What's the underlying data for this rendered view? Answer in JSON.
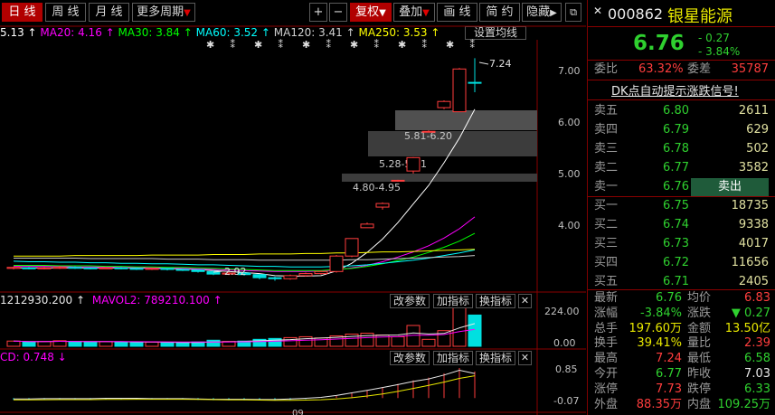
{
  "toolbar": {
    "period_buttons": [
      "日 线",
      "周 线",
      "月 线",
      "更多周期"
    ],
    "more_arrow": "▼",
    "zoom_in": "+",
    "zoom_out": "−",
    "fuquan": "复权",
    "fuquan_arrow": "▼",
    "overlay": "叠加",
    "overlay_arrow": "▼",
    "draw_line": "画 线",
    "brief": "简 约",
    "hide": "隐藏",
    "hide_arrow": "▶",
    "restore": "⧉",
    "close": "✕"
  },
  "ma_legend": {
    "ma5": "5.13 ↑",
    "ma20": "MA20: 4.16 ↑",
    "ma30": "MA30: 3.84 ↑",
    "ma60": "MA60: 3.52 ↑",
    "ma120": "MA120: 3.41 ↑",
    "ma250": "MA250: 3.53 ↑",
    "setting": "设置均线"
  },
  "price_axis": [
    "7.00",
    "6.00",
    "5.00",
    "4.00"
  ],
  "annotations": {
    "high": "7.24",
    "low": "2.92",
    "zones": [
      "5.81-6.20",
      "5.28-5.31",
      "4.80-4.95"
    ]
  },
  "vol_panel": {
    "legend_a": "1212930.200 ↑",
    "legend_b": "MAVOL2: 789210.100 ↑",
    "axis": [
      "224.00",
      "0.00"
    ],
    "buttons": [
      "改参数",
      "加指标",
      "换指标"
    ],
    "close": "✕"
  },
  "macd_panel": {
    "legend": "CD: 0.748 ↓",
    "axis": [
      "0.85",
      "-0.07"
    ],
    "buttons": [
      "改参数",
      "加指标",
      "换指标"
    ],
    "close": "✕"
  },
  "bottom_label": "09",
  "quote": {
    "code": "000862",
    "name": "银星能源",
    "price": "6.76",
    "change": "- 0.27",
    "change_pct": "- 3.84%",
    "weibi_label": "委比",
    "weibi": "63.32%",
    "weicha_label": "委差",
    "weicha": "35787",
    "signal": "DK点自动提示涨跌信号!",
    "sell": [
      {
        "label": "卖五",
        "price": "6.80",
        "vol": "2611"
      },
      {
        "label": "卖四",
        "price": "6.79",
        "vol": "629"
      },
      {
        "label": "卖三",
        "price": "6.78",
        "vol": "502"
      },
      {
        "label": "卖二",
        "price": "6.77",
        "vol": "3582"
      },
      {
        "label": "卖一",
        "price": "6.76",
        "vol": "卖出"
      }
    ],
    "buy": [
      {
        "label": "买一",
        "price": "6.75",
        "vol": "18735"
      },
      {
        "label": "买二",
        "price": "6.74",
        "vol": "9338"
      },
      {
        "label": "买三",
        "price": "6.73",
        "vol": "4017"
      },
      {
        "label": "买四",
        "price": "6.72",
        "vol": "11656"
      },
      {
        "label": "买五",
        "price": "6.71",
        "vol": "2405"
      }
    ],
    "stats": [
      {
        "l1": "最新",
        "v1": "6.76",
        "l2": "均价",
        "v2": "6.83"
      },
      {
        "l1": "涨幅",
        "v1": "-3.84%",
        "l2": "涨跌",
        "v2": "▼ 0.27"
      },
      {
        "l1": "总手",
        "v1": "197.60万",
        "l2": "金额",
        "v2": "13.50亿"
      },
      {
        "l1": "换手",
        "v1": "39.41%",
        "l2": "量比",
        "v2": "2.39"
      },
      {
        "l1": "最高",
        "v1": "7.24",
        "l2": "最低",
        "v2": "6.58"
      },
      {
        "l1": "今开",
        "v1": "6.77",
        "l2": "昨收",
        "v2": "7.03"
      },
      {
        "l1": "涨停",
        "v1": "7.73",
        "l2": "跌停",
        "v2": "6.33"
      },
      {
        "l1": "外盘",
        "v1": "88.35万",
        "l2": "内盘",
        "v2": "109.25万"
      }
    ]
  },
  "colors": {
    "up": "#ff3d3d",
    "down": "#00e0e0",
    "ma5": "#ffffff",
    "ma20": "#ff00ff",
    "ma30": "#00ff00",
    "ma60": "#00ffff",
    "ma120": "#ffffff",
    "ma250": "#ffff00",
    "accent": "#b10000"
  },
  "chart_data": {
    "type": "candlestick",
    "price_axis_ticks": [
      4.0,
      5.0,
      6.0,
      7.0
    ],
    "candles": [
      {
        "o": 3.16,
        "c": 3.18,
        "h": 3.2,
        "l": 3.14
      },
      {
        "o": 3.17,
        "c": 3.16,
        "h": 3.19,
        "l": 3.14
      },
      {
        "o": 3.16,
        "c": 3.17,
        "h": 3.19,
        "l": 3.14
      },
      {
        "o": 3.17,
        "c": 3.18,
        "h": 3.21,
        "l": 3.15
      },
      {
        "o": 3.18,
        "c": 3.17,
        "h": 3.2,
        "l": 3.15
      },
      {
        "o": 3.17,
        "c": 3.16,
        "h": 3.18,
        "l": 3.14
      },
      {
        "o": 3.16,
        "c": 3.17,
        "h": 3.19,
        "l": 3.15
      },
      {
        "o": 3.17,
        "c": 3.16,
        "h": 3.19,
        "l": 3.14
      },
      {
        "o": 3.16,
        "c": 3.15,
        "h": 3.18,
        "l": 3.13
      },
      {
        "o": 3.15,
        "c": 3.16,
        "h": 3.17,
        "l": 3.13
      },
      {
        "o": 3.16,
        "c": 3.14,
        "h": 3.17,
        "l": 3.12
      },
      {
        "o": 3.14,
        "c": 3.13,
        "h": 3.16,
        "l": 3.11
      },
      {
        "o": 3.13,
        "c": 3.1,
        "h": 3.14,
        "l": 3.08
      },
      {
        "o": 3.1,
        "c": 3.05,
        "h": 3.12,
        "l": 3.03
      },
      {
        "o": 3.05,
        "c": 3.07,
        "h": 3.09,
        "l": 3.03
      },
      {
        "o": 3.07,
        "c": 3.04,
        "h": 3.09,
        "l": 3.02
      },
      {
        "o": 3.04,
        "c": 2.98,
        "h": 3.05,
        "l": 2.95
      },
      {
        "o": 2.98,
        "c": 2.96,
        "h": 3.0,
        "l": 2.92
      },
      {
        "o": 2.96,
        "c": 3.02,
        "h": 3.04,
        "l": 2.94
      },
      {
        "o": 3.02,
        "c": 3.06,
        "h": 3.08,
        "l": 3.0
      },
      {
        "o": 3.06,
        "c": 3.1,
        "h": 3.12,
        "l": 3.04
      },
      {
        "o": 3.1,
        "c": 3.4,
        "h": 3.42,
        "l": 3.08
      },
      {
        "o": 3.4,
        "c": 3.74,
        "h": 3.74,
        "l": 3.38
      },
      {
        "o": 3.95,
        "c": 4.02,
        "h": 4.05,
        "l": 3.95
      },
      {
        "o": 4.35,
        "c": 4.42,
        "h": 4.44,
        "l": 4.3
      },
      {
        "o": 4.86,
        "c": 4.87,
        "h": 4.88,
        "l": 4.84
      },
      {
        "o": 5.05,
        "c": 5.31,
        "h": 5.32,
        "l": 5.0
      },
      {
        "o": 5.81,
        "c": 5.82,
        "h": 5.84,
        "l": 5.8
      },
      {
        "o": 6.28,
        "c": 6.4,
        "h": 6.42,
        "l": 6.25
      },
      {
        "o": 6.2,
        "c": 7.03,
        "h": 7.05,
        "l": 6.2
      },
      {
        "o": 6.77,
        "c": 6.76,
        "h": 7.24,
        "l": 6.58
      }
    ],
    "ma_lines": [
      {
        "name": "MA5",
        "values": [
          3.17,
          3.17,
          3.17,
          3.17,
          3.17,
          3.17,
          3.17,
          3.17,
          3.17,
          3.16,
          3.16,
          3.15,
          3.14,
          3.12,
          3.1,
          3.08,
          3.06,
          3.02,
          3.01,
          3.01,
          3.02,
          3.11,
          3.26,
          3.47,
          3.73,
          4.05,
          4.41,
          4.77,
          5.21,
          5.69,
          6.25
        ]
      },
      {
        "name": "MA20",
        "values": [
          3.2,
          3.2,
          3.2,
          3.2,
          3.19,
          3.19,
          3.19,
          3.18,
          3.18,
          3.17,
          3.17,
          3.16,
          3.15,
          3.14,
          3.13,
          3.12,
          3.11,
          3.1,
          3.1,
          3.1,
          3.11,
          3.13,
          3.17,
          3.22,
          3.29,
          3.38,
          3.48,
          3.6,
          3.75,
          3.93,
          4.16
        ]
      },
      {
        "name": "MA30",
        "values": [
          3.22,
          3.22,
          3.22,
          3.21,
          3.21,
          3.21,
          3.2,
          3.2,
          3.19,
          3.19,
          3.18,
          3.18,
          3.17,
          3.16,
          3.15,
          3.14,
          3.13,
          3.12,
          3.12,
          3.12,
          3.12,
          3.14,
          3.16,
          3.2,
          3.25,
          3.31,
          3.38,
          3.47,
          3.57,
          3.69,
          3.84
        ]
      },
      {
        "name": "MA60",
        "values": [
          3.3,
          3.29,
          3.29,
          3.28,
          3.28,
          3.27,
          3.27,
          3.26,
          3.26,
          3.25,
          3.25,
          3.24,
          3.23,
          3.23,
          3.22,
          3.21,
          3.2,
          3.2,
          3.19,
          3.19,
          3.19,
          3.2,
          3.21,
          3.23,
          3.26,
          3.29,
          3.32,
          3.36,
          3.41,
          3.46,
          3.52
        ]
      },
      {
        "name": "MA120",
        "values": [
          3.36,
          3.36,
          3.36,
          3.36,
          3.36,
          3.35,
          3.35,
          3.35,
          3.35,
          3.35,
          3.34,
          3.34,
          3.34,
          3.33,
          3.33,
          3.33,
          3.32,
          3.32,
          3.32,
          3.32,
          3.32,
          3.32,
          3.33,
          3.33,
          3.34,
          3.35,
          3.36,
          3.37,
          3.38,
          3.39,
          3.41
        ]
      },
      {
        "name": "MA250",
        "values": [
          3.4,
          3.4,
          3.4,
          3.4,
          3.41,
          3.41,
          3.41,
          3.41,
          3.41,
          3.42,
          3.42,
          3.42,
          3.42,
          3.43,
          3.43,
          3.43,
          3.44,
          3.44,
          3.44,
          3.45,
          3.45,
          3.46,
          3.46,
          3.47,
          3.48,
          3.48,
          3.49,
          3.5,
          3.51,
          3.52,
          3.53
        ]
      }
    ],
    "volume": [
      30,
      25,
      28,
      32,
      26,
      24,
      27,
      25,
      22,
      24,
      20,
      22,
      25,
      35,
      28,
      30,
      40,
      45,
      50,
      55,
      48,
      60,
      70,
      75,
      65,
      55,
      120,
      40,
      90,
      224,
      180
    ],
    "vol_axis": [
      0,
      224
    ],
    "macd": [
      -0.05,
      -0.05,
      -0.04,
      -0.04,
      -0.04,
      -0.04,
      -0.03,
      -0.03,
      -0.03,
      -0.04,
      -0.04,
      -0.04,
      -0.05,
      -0.06,
      -0.06,
      -0.06,
      -0.07,
      -0.07,
      -0.05,
      -0.03,
      0.0,
      0.06,
      0.14,
      0.22,
      0.31,
      0.4,
      0.5,
      0.58,
      0.7,
      0.85,
      0.75
    ],
    "macd_axis": [
      -0.07,
      0.85
    ]
  }
}
